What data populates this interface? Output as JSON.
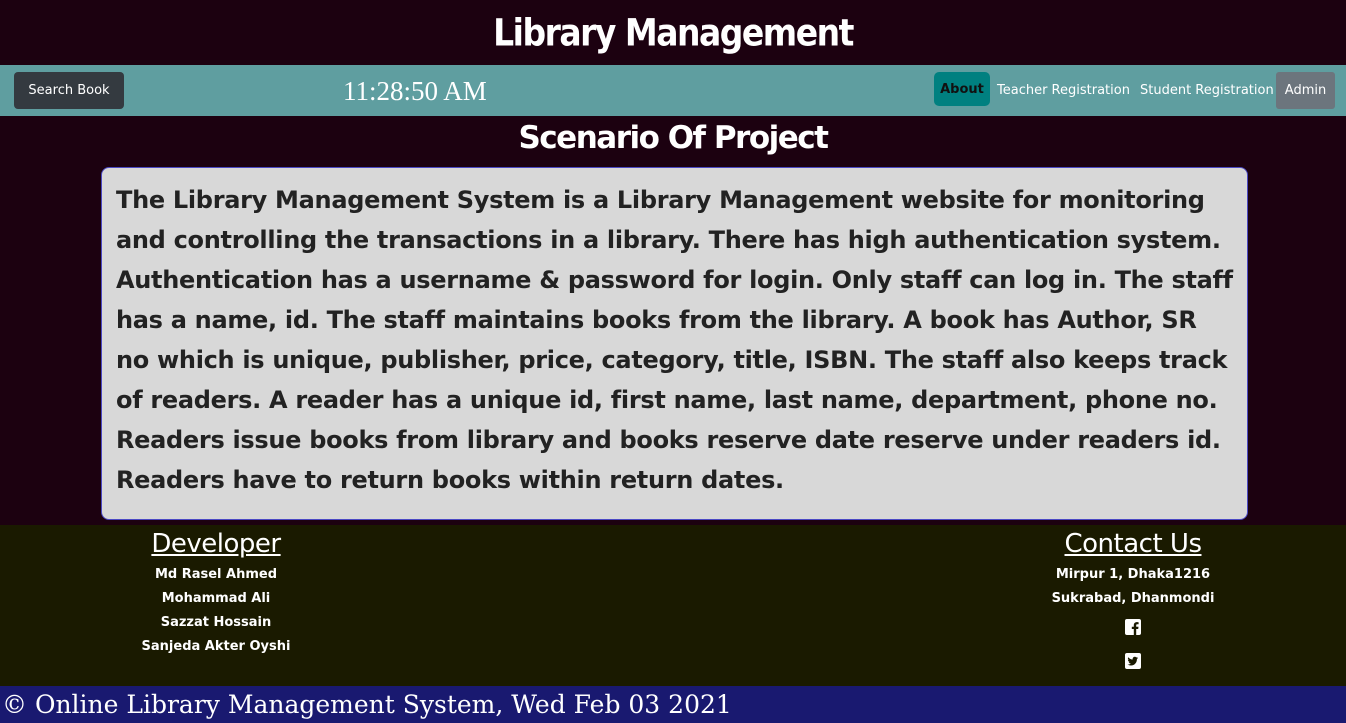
{
  "header": {
    "title": "Library Management"
  },
  "navbar": {
    "search_button": "Search Book",
    "clock": "11:28:50 AM",
    "about": "About",
    "teacher_registration": "Teacher Registration",
    "student_registration": "Student Registration",
    "admin": "Admin"
  },
  "main": {
    "title": "Scenario Of Project",
    "description": "The Library Management System is a Library Management website for monitoring and controlling the transactions in a library. There has high authentication system. Authentication has a username & password for login. Only staff can log in. The staff has a name, id. The staff maintains books from the library. A book has Author, SR no which is unique, publisher, price, category, title, ISBN. The staff also keeps track of readers. A reader has a unique id, first name, last name, department, phone no. Readers issue books from library and books reserve date reserve under readers id. Readers have to return books within return dates."
  },
  "footer": {
    "developer": {
      "heading": "Developer",
      "names": [
        "Md Rasel Ahmed",
        "Mohammad Ali",
        "Sazzat Hossain",
        "Sanjeda Akter Oyshi"
      ]
    },
    "contact": {
      "heading": "Contact Us",
      "lines": [
        "Mirpur 1, Dhaka1216",
        "Sukrabad, Dhanmondi"
      ],
      "social_icons": [
        "facebook-icon",
        "twitter-icon"
      ]
    },
    "copyright": "© Online Library Management System, Wed Feb 03 2021"
  },
  "colors": {
    "page_background": "#1c0110",
    "navbar": "#5f9ea0",
    "about_button": "#008080",
    "admin_button": "#6c757d",
    "search_button": "#343a40",
    "scenario_box": "#d8d8d8",
    "footer": "#1a1a00",
    "copyright_bar": "#191970"
  }
}
